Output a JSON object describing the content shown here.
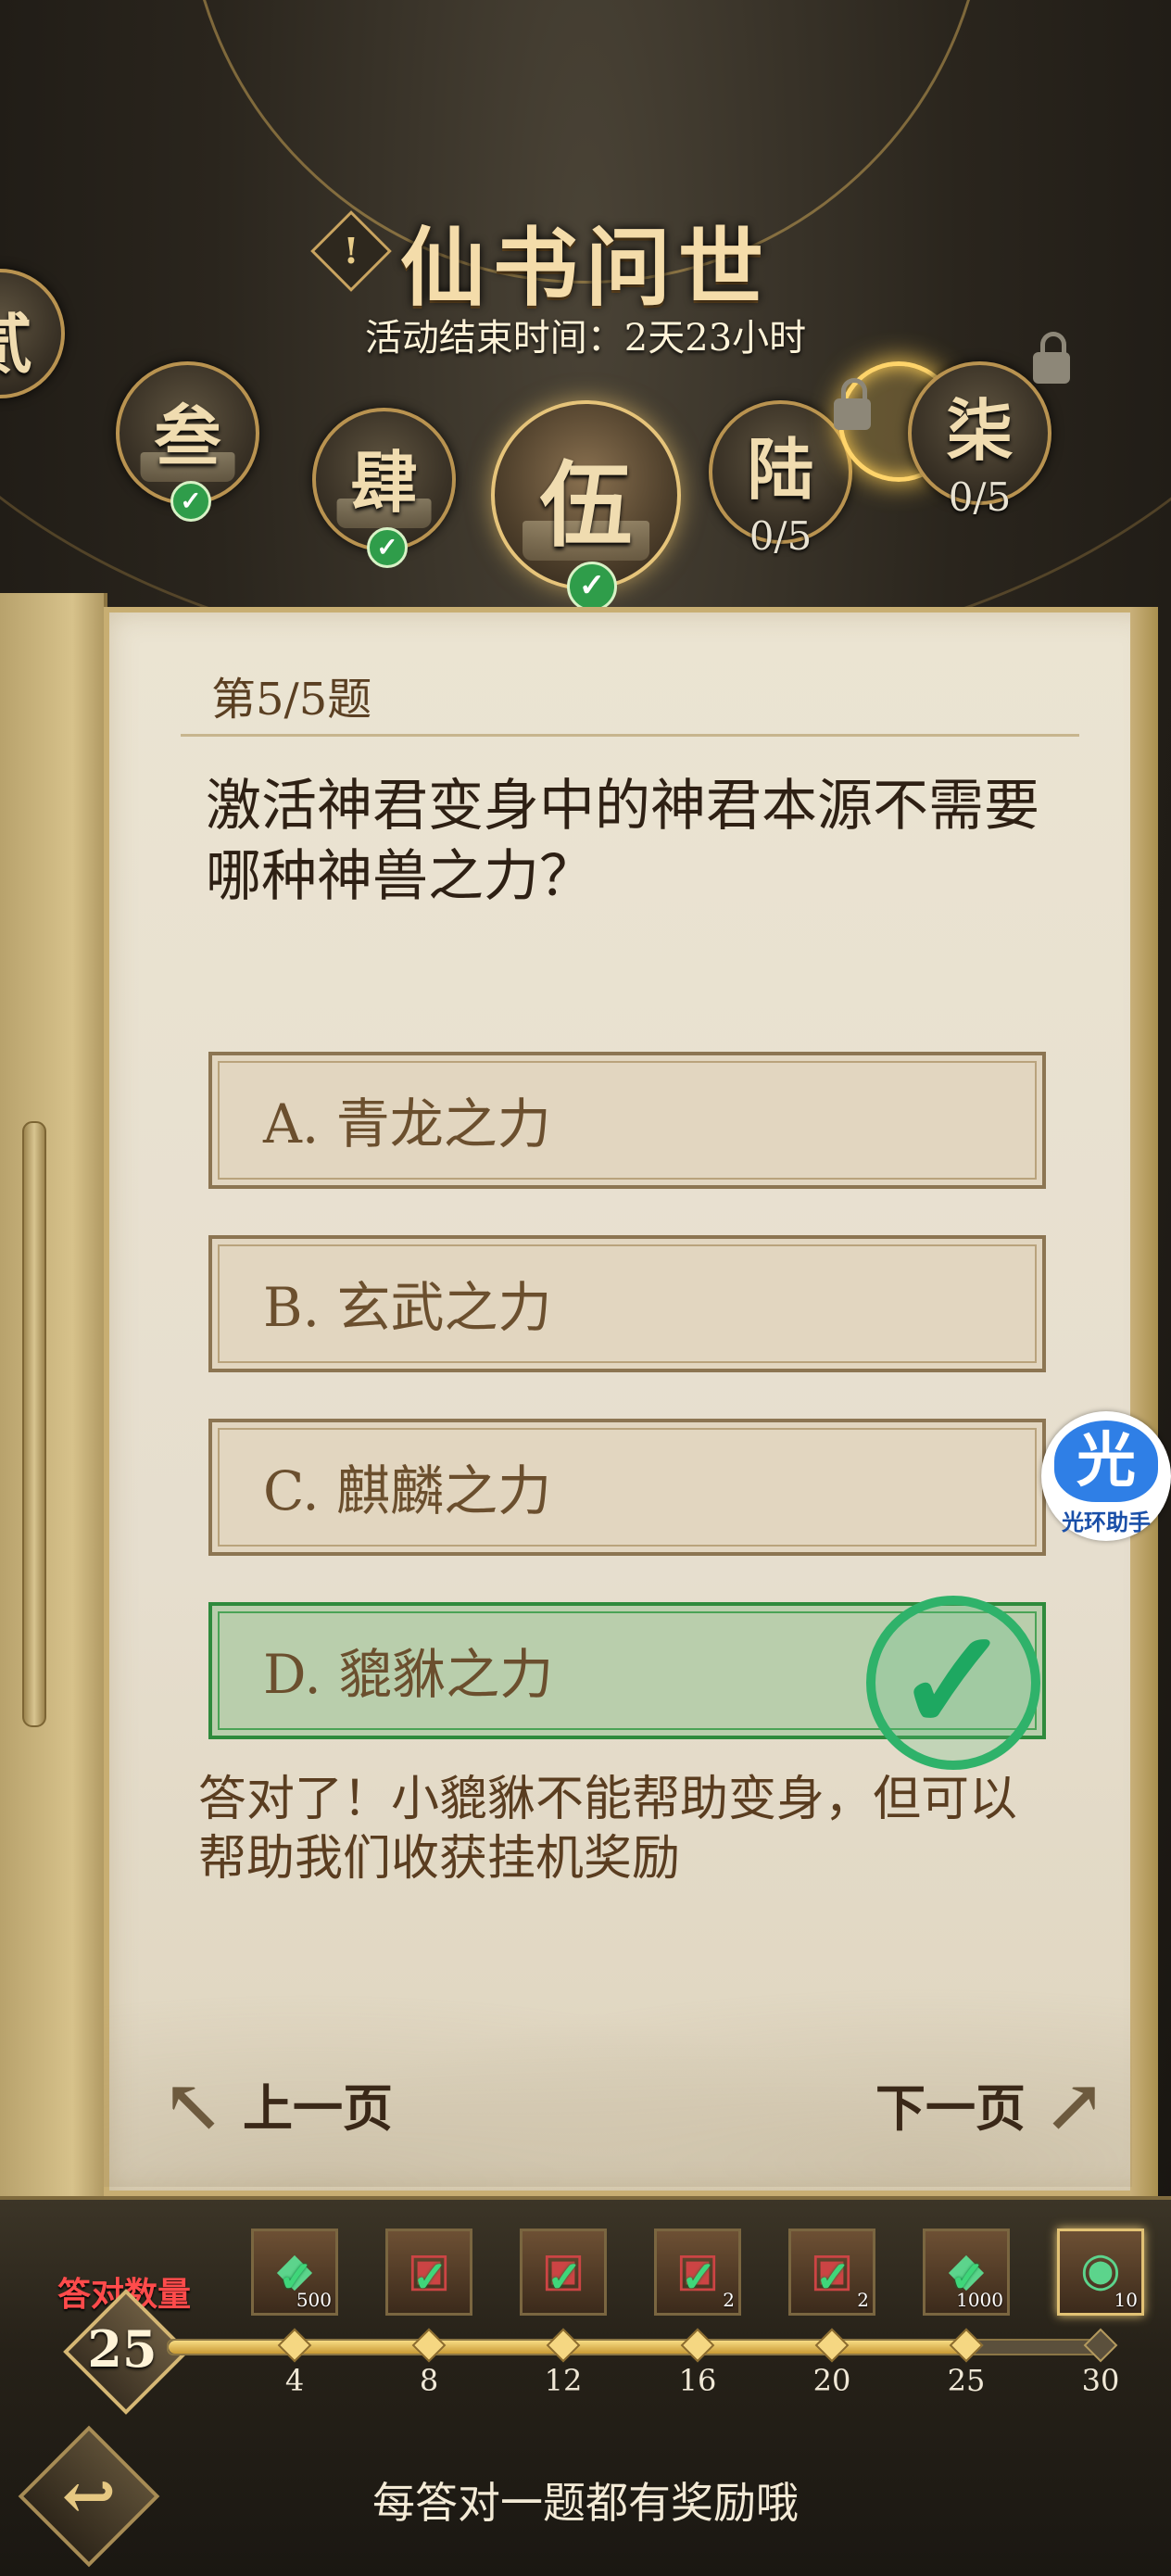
{
  "header": {
    "title": "仙书问世",
    "info_icon": "!",
    "timer": "活动结束时间：2天23小时"
  },
  "chapters": [
    {
      "label": "贰",
      "status": "completed"
    },
    {
      "label": "叁",
      "status": "completed"
    },
    {
      "label": "肆",
      "status": "completed"
    },
    {
      "label": "伍",
      "status": "active-completed"
    },
    {
      "label": "陆",
      "progress": "0/5",
      "status": "locked"
    },
    {
      "label": "柒",
      "progress": "0/5",
      "status": "locked"
    }
  ],
  "quiz": {
    "number": "第5/5题",
    "question": "激活神君变身中的神君本源不需要哪种神兽之力？",
    "options": [
      {
        "label": "A. 青龙之力"
      },
      {
        "label": "B. 玄武之力"
      },
      {
        "label": "C. 麒麟之力"
      },
      {
        "label": "D. 貔貅之力",
        "correct": true
      }
    ],
    "feedback": "答对了！小貔貅不能帮助变身，但可以帮助我们收获挂机奖励",
    "prev": "上一页",
    "next": "下一页"
  },
  "progress": {
    "label": "答对数量",
    "count": "25",
    "current": 25,
    "max": 30,
    "milestones": [
      "4",
      "8",
      "12",
      "16",
      "20",
      "25",
      "30"
    ],
    "rewards": [
      {
        "icon": "gem-icon",
        "qty": "500",
        "claimed": true
      },
      {
        "icon": "chest-icon",
        "qty": "",
        "claimed": true
      },
      {
        "icon": "chest-icon",
        "qty": "",
        "claimed": true
      },
      {
        "icon": "chest-icon",
        "qty": "2",
        "claimed": true
      },
      {
        "icon": "chest-icon",
        "qty": "2",
        "claimed": true
      },
      {
        "icon": "gem-icon",
        "qty": "1000",
        "claimed": true
      },
      {
        "icon": "jade-icon",
        "qty": "10",
        "claimed": false
      }
    ],
    "hint": "每答对一题都有奖励哦"
  },
  "helper": {
    "glyph": "光",
    "label": "光环助手"
  },
  "colors": {
    "correct_green": "#2e8a3c",
    "accent_gold": "#c9a460",
    "count_red": "#ff4b4b"
  }
}
